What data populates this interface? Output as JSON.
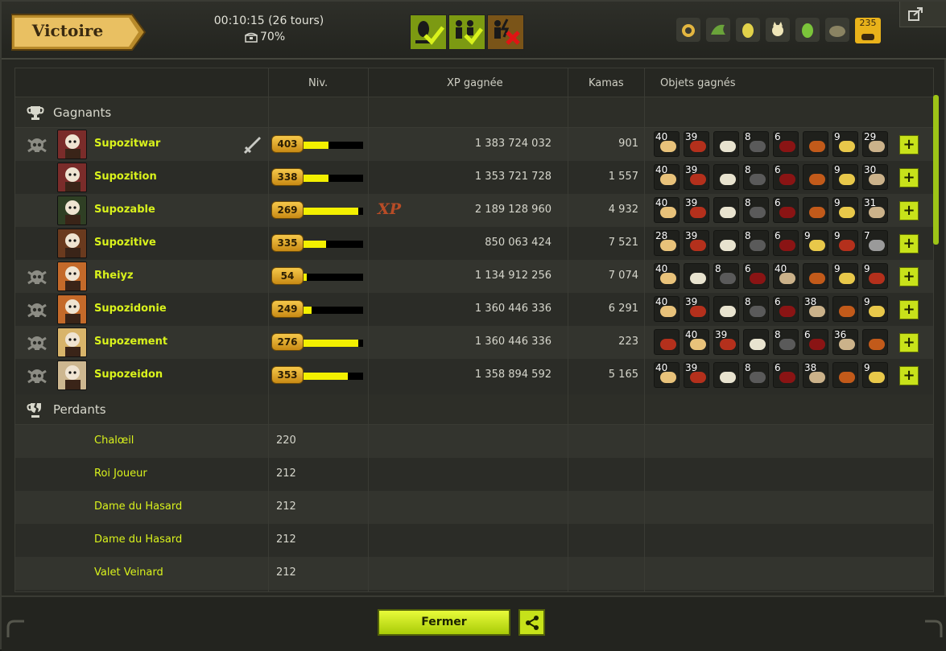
{
  "header": {
    "result": "Victoire",
    "time": "00:10:15 (26 tours)",
    "chest_pct": "70%",
    "resource_badge": "235",
    "resource_icons": [
      "gold-ring-icon",
      "green-dragon-icon",
      "yellow-egg-icon",
      "cream-cat-icon",
      "green-egg-icon",
      "stone-creature-icon"
    ]
  },
  "columns": {
    "level": "Niv.",
    "xp": "XP gagnée",
    "kamas": "Kamas",
    "items": "Objets gagnés"
  },
  "sections": {
    "winners": "Gagnants",
    "losers": "Perdants"
  },
  "winners": [
    {
      "name": "Supozitwar",
      "level": "403",
      "level_pct": 0.42,
      "xp": "1 383 724 032",
      "kamas": "901",
      "dead": true,
      "leader": true,
      "items": [
        {
          "q": "40",
          "c": "#e8c27a"
        },
        {
          "q": "39",
          "c": "#b4301c"
        },
        {
          "q": "",
          "c": "#e8e3cf"
        },
        {
          "q": "8",
          "c": "#5a5a5a"
        },
        {
          "q": "6",
          "c": "#8a1414"
        },
        {
          "q": "",
          "c": "#c25a1a"
        },
        {
          "q": "9",
          "c": "#e8c84a"
        },
        {
          "q": "29",
          "c": "#cbb28a"
        }
      ]
    },
    {
      "name": "Supozition",
      "level": "338",
      "level_pct": 0.42,
      "xp": "1 353 721 728",
      "kamas": "1 557",
      "dead": false,
      "leader": false,
      "items": [
        {
          "q": "40",
          "c": "#e8c27a"
        },
        {
          "q": "39",
          "c": "#b4301c"
        },
        {
          "q": "",
          "c": "#e8e3cf"
        },
        {
          "q": "8",
          "c": "#5a5a5a"
        },
        {
          "q": "6",
          "c": "#8a1414"
        },
        {
          "q": "",
          "c": "#c25a1a"
        },
        {
          "q": "9",
          "c": "#e8c84a"
        },
        {
          "q": "30",
          "c": "#cbb28a"
        }
      ]
    },
    {
      "name": "Supozable",
      "level": "269",
      "level_pct": 0.92,
      "xp": "2 189 128 960",
      "kamas": "4 932",
      "dead": false,
      "leader": false,
      "xp_bonus": "XP",
      "items": [
        {
          "q": "40",
          "c": "#e8c27a"
        },
        {
          "q": "39",
          "c": "#b4301c"
        },
        {
          "q": "",
          "c": "#e8e3cf"
        },
        {
          "q": "8",
          "c": "#5a5a5a"
        },
        {
          "q": "6",
          "c": "#8a1414"
        },
        {
          "q": "",
          "c": "#c25a1a"
        },
        {
          "q": "9",
          "c": "#e8c84a"
        },
        {
          "q": "31",
          "c": "#cbb28a"
        }
      ]
    },
    {
      "name": "Supozitive",
      "level": "335",
      "level_pct": 0.38,
      "xp": "850 063 424",
      "kamas": "7 521",
      "dead": false,
      "leader": false,
      "items": [
        {
          "q": "28",
          "c": "#e8c27a"
        },
        {
          "q": "39",
          "c": "#b4301c"
        },
        {
          "q": "",
          "c": "#e8e3cf"
        },
        {
          "q": "8",
          "c": "#5a5a5a"
        },
        {
          "q": "6",
          "c": "#8a1414"
        },
        {
          "q": "9",
          "c": "#e8c84a"
        },
        {
          "q": "9",
          "c": "#b4301c"
        },
        {
          "q": "7",
          "c": "#9a9a9a"
        }
      ]
    },
    {
      "name": "Rheiyz",
      "level": "54",
      "level_pct": 0.06,
      "xp": "1 134 912 256",
      "kamas": "7 074",
      "dead": true,
      "leader": false,
      "items": [
        {
          "q": "40",
          "c": "#e8c27a"
        },
        {
          "q": "",
          "c": "#e8e3cf"
        },
        {
          "q": "8",
          "c": "#5a5a5a"
        },
        {
          "q": "6",
          "c": "#8a1414"
        },
        {
          "q": "40",
          "c": "#cbb28a"
        },
        {
          "q": "",
          "c": "#c25a1a"
        },
        {
          "q": "9",
          "c": "#e8c84a"
        },
        {
          "q": "9",
          "c": "#b4301c"
        }
      ]
    },
    {
      "name": "Supozidonie",
      "level": "249",
      "level_pct": 0.14,
      "xp": "1 360 446 336",
      "kamas": "6 291",
      "dead": true,
      "leader": false,
      "items": [
        {
          "q": "40",
          "c": "#e8c27a"
        },
        {
          "q": "39",
          "c": "#b4301c"
        },
        {
          "q": "",
          "c": "#e8e3cf"
        },
        {
          "q": "8",
          "c": "#5a5a5a"
        },
        {
          "q": "6",
          "c": "#8a1414"
        },
        {
          "q": "38",
          "c": "#cbb28a"
        },
        {
          "q": "",
          "c": "#c25a1a"
        },
        {
          "q": "9",
          "c": "#e8c84a"
        }
      ]
    },
    {
      "name": "Supozement",
      "level": "276",
      "level_pct": 0.92,
      "xp": "1 360 446 336",
      "kamas": "223",
      "dead": true,
      "leader": false,
      "items": [
        {
          "q": "",
          "c": "#b4301c"
        },
        {
          "q": "40",
          "c": "#e8c27a"
        },
        {
          "q": "39",
          "c": "#b4301c"
        },
        {
          "q": "",
          "c": "#e8e3cf"
        },
        {
          "q": "8",
          "c": "#5a5a5a"
        },
        {
          "q": "6",
          "c": "#8a1414"
        },
        {
          "q": "36",
          "c": "#cbb28a"
        },
        {
          "q": "",
          "c": "#c25a1a"
        }
      ]
    },
    {
      "name": "Supozeidon",
      "level": "353",
      "level_pct": 0.74,
      "xp": "1 358 894 592",
      "kamas": "5 165",
      "dead": true,
      "leader": false,
      "items": [
        {
          "q": "40",
          "c": "#e8c27a"
        },
        {
          "q": "39",
          "c": "#b4301c"
        },
        {
          "q": "",
          "c": "#e8e3cf"
        },
        {
          "q": "8",
          "c": "#5a5a5a"
        },
        {
          "q": "6",
          "c": "#8a1414"
        },
        {
          "q": "38",
          "c": "#cbb28a"
        },
        {
          "q": "",
          "c": "#c25a1a"
        },
        {
          "q": "9",
          "c": "#e8c84a"
        }
      ]
    }
  ],
  "losers": [
    {
      "name": "Chalœil",
      "level": "220"
    },
    {
      "name": "Roi Joueur",
      "level": "212"
    },
    {
      "name": "Dame du Hasard",
      "level": "212"
    },
    {
      "name": "Dame du Hasard",
      "level": "212"
    },
    {
      "name": "Valet Veinard",
      "level": "212"
    }
  ],
  "footer": {
    "close_label": "Fermer"
  },
  "colors": {
    "accent": "#d9f21c",
    "flag_ok": "#7c9a12",
    "flag_ko": "#7a5418",
    "xp_bar": "#f3f000"
  }
}
